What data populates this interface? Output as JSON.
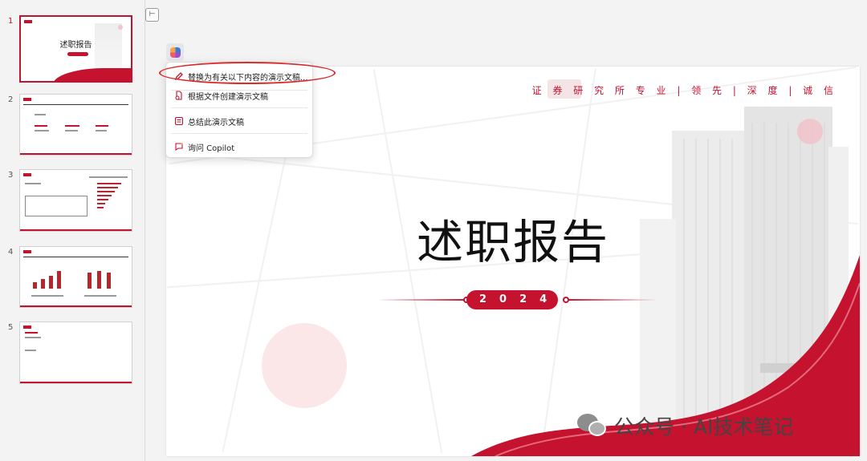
{
  "thumbnails": {
    "items": [
      {
        "number": "1",
        "title": "述职报告"
      },
      {
        "number": "2"
      },
      {
        "number": "3"
      },
      {
        "number": "4"
      },
      {
        "number": "5"
      }
    ]
  },
  "slide": {
    "tagline": "证 券 研 究 所   专 业 | 领 先 | 深 度 | 诚 信",
    "title": "述职报告",
    "year": "2024"
  },
  "copilot_menu": {
    "items": [
      {
        "label": "替换为有关以下内容的演示文稿...",
        "icon": "pencil-icon"
      },
      {
        "label": "根据文件创建演示文稿",
        "icon": "file-create-icon"
      },
      {
        "label": "总结此演示文稿",
        "icon": "summary-icon"
      },
      {
        "label": "询问 Copilot",
        "icon": "copilot-chat-icon"
      }
    ]
  },
  "watermark": {
    "text": "公众号 · AI技术笔记"
  },
  "colors": {
    "accent": "#c4122f",
    "highlight": "#d92b2b"
  }
}
